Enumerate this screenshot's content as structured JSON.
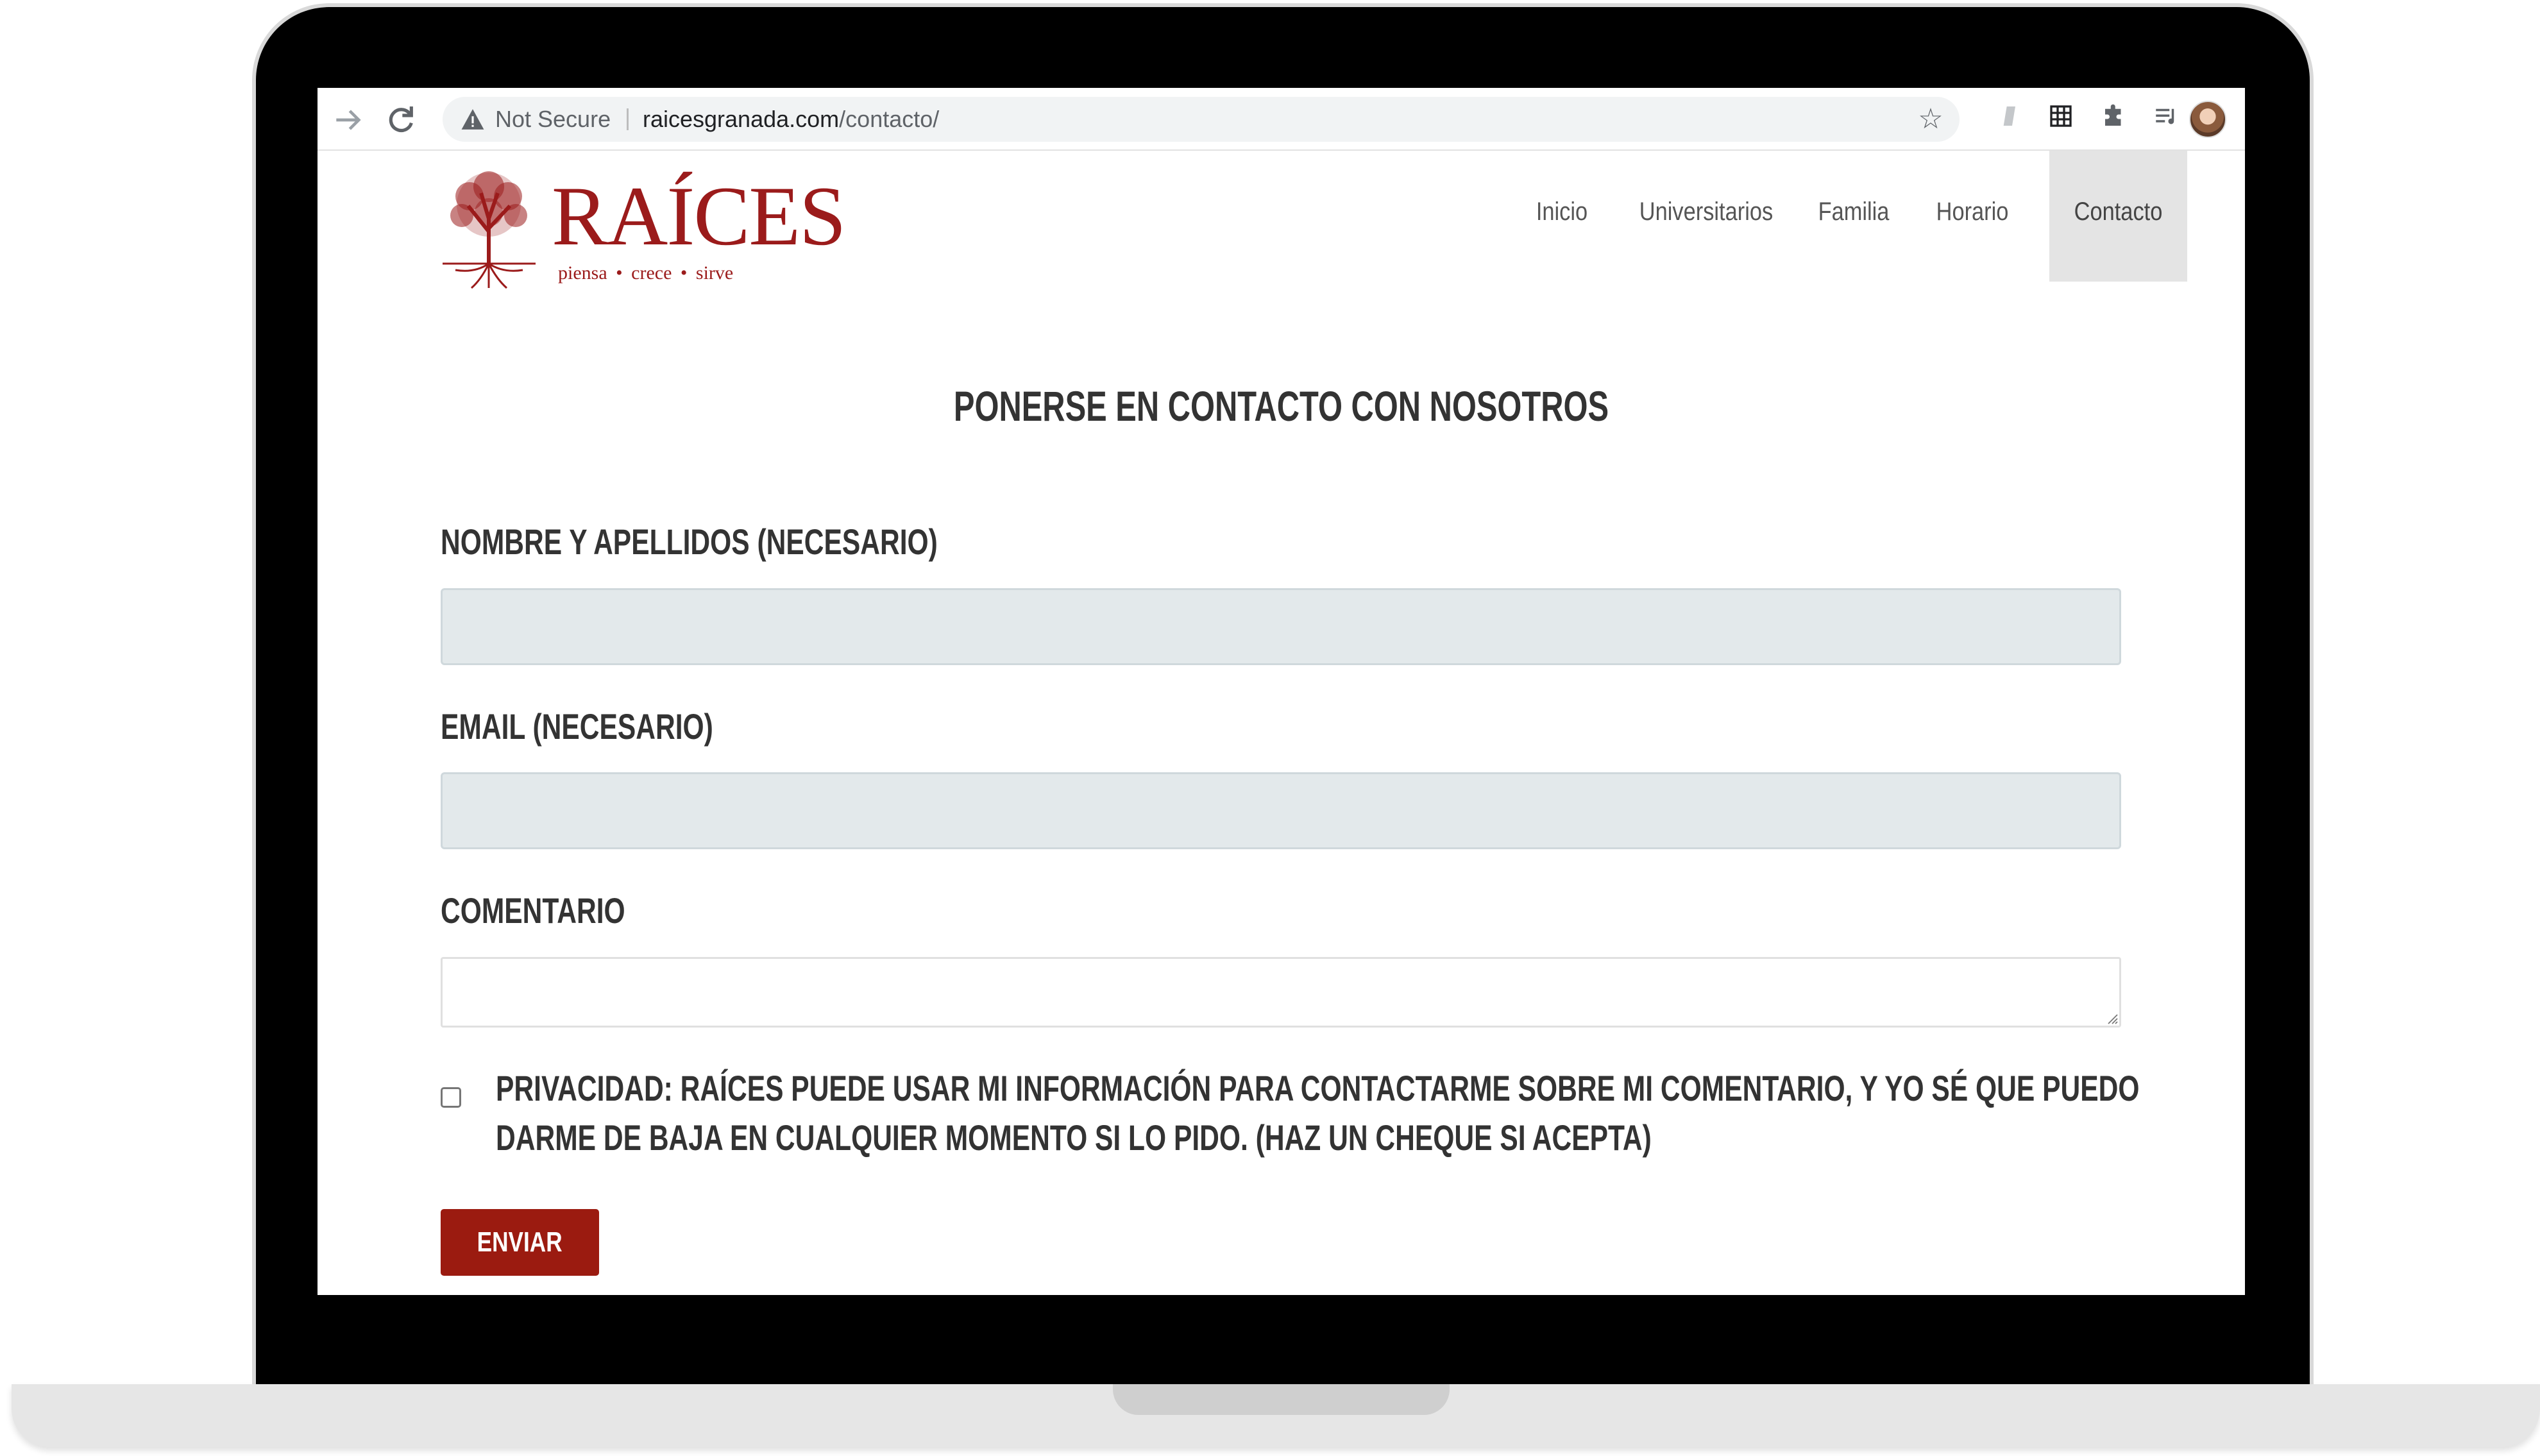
{
  "browser": {
    "security_label": "Not Secure",
    "url_domain": "raicesgranada.com",
    "url_path": "/contacto/",
    "icons": [
      "forward-arrow-icon",
      "reload-icon",
      "warning-icon",
      "star-icon",
      "extension-icon",
      "grid-icon",
      "puzzle-icon",
      "media-icon"
    ]
  },
  "site": {
    "logo": {
      "wordmark": "RAÍCES",
      "tagline": "piensa  •  crece  •  sirve",
      "color": "#9b1b1b"
    },
    "nav": {
      "items": [
        "Inicio",
        "Universitarios",
        "Familia",
        "Horario",
        "Contacto"
      ],
      "active": "Contacto"
    }
  },
  "form": {
    "title": "PONERSE EN CONTACTO CON NOSOTROS",
    "name_label": "NOMBRE Y APELLIDOS (NECESARIO)",
    "name_value": "",
    "email_label": "EMAIL (NECESARIO)",
    "email_value": "",
    "comment_label": "COMENTARIO",
    "comment_value": "",
    "privacy_checked": false,
    "privacy_text": "PRIVACIDAD: RAÍCES PUEDE USAR MI INFORMACIÓN PARA CONTACTARME SOBRE MI COMENTARIO, Y YO SÉ QUE PUEDO DARME DE BAJA EN CUALQUIER MOMENTO SI LO PIDO. (HAZ UN CHEQUE SI ACEPTA)",
    "submit_label": "ENVIAR",
    "accent_color": "#9b1b10"
  }
}
